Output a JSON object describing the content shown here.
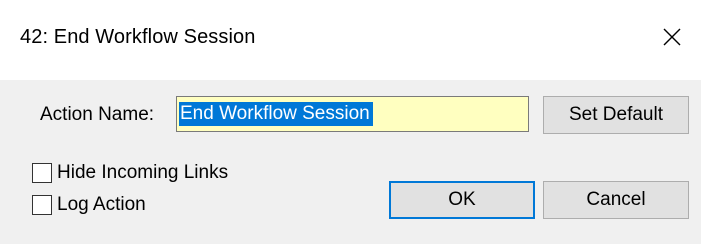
{
  "window": {
    "title": "42: End Workflow Session",
    "close_icon": "close-icon"
  },
  "form": {
    "action_name_label": "Action Name:",
    "action_name_value": "End Workflow Session",
    "set_default_label": "Set Default",
    "hide_incoming_links_label": "Hide Incoming Links",
    "hide_incoming_links_checked": false,
    "log_action_label": "Log Action",
    "log_action_checked": false,
    "ok_label": "OK",
    "cancel_label": "Cancel"
  },
  "colors": {
    "input_background": "#ffffc0",
    "selection": "#0078d7",
    "default_button_border": "#0078d7"
  }
}
